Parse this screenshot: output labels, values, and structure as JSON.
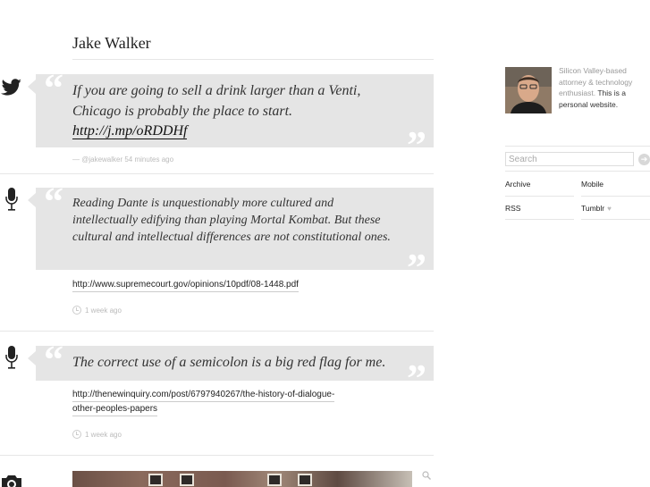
{
  "blog": {
    "title": "Jake Walker"
  },
  "posts": [
    {
      "type_icon": "twitter-bird-icon",
      "text": "If you are going to sell a drink larger than a Venti, Chicago is probably the place to start.",
      "link_text": "http://j.mp/oRDDHf",
      "meta": "— @jakewalker 54 minutes ago"
    },
    {
      "type_icon": "microphone-icon",
      "text": "Reading Dante is unquestionably more cultured and intellectually edifying than playing Mortal Kombat. But these cultural and intellectual differences are not constitutional ones.",
      "source_link": "http://www.supremecourt.gov/opinions/10pdf/08-1448.pdf",
      "meta": "1 week ago"
    },
    {
      "type_icon": "microphone-icon",
      "text": "The correct use of a semicolon is a big red flag for me.",
      "source_link_line1": "http://thenewinquiry.com/post/6797940267/the-history-of-dialogue-",
      "source_link_line2": "other-peoples-papers",
      "meta": "1 week ago"
    },
    {
      "type_icon": "camera-icon"
    }
  ],
  "sidebar": {
    "bio_plain": "Silicon Valley-based attorney & technology enthusiast.",
    "bio_emph": "This is a personal website.",
    "search_placeholder": "Search",
    "search_go": "➔",
    "links": {
      "archive": "Archive",
      "mobile": "Mobile",
      "rss": "RSS",
      "tumblr": "Tumblr"
    }
  },
  "colors": {
    "bubble": "#e5e5e5",
    "rule": "#e6e6e6",
    "meta_text": "#bbbbbb"
  }
}
